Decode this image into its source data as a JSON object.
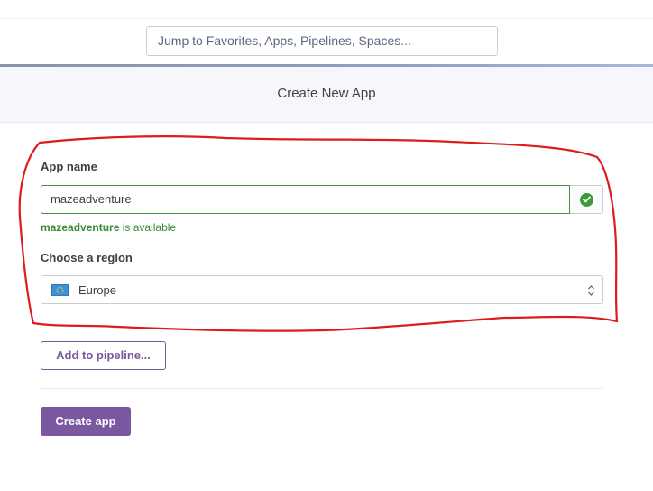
{
  "search": {
    "placeholder": "Jump to Favorites, Apps, Pipelines, Spaces..."
  },
  "header": {
    "title": "Create New App"
  },
  "form": {
    "app_name_label": "App name",
    "app_name_value": "mazeadventure",
    "availability_name": "mazeadventure",
    "availability_suffix": " is available",
    "region_label": "Choose a region",
    "region_value": "Europe",
    "region_icon": "eu-flag-icon",
    "status_icon": "check-circle-icon"
  },
  "actions": {
    "pipeline_label": "Add to pipeline...",
    "create_label": "Create app"
  },
  "colors": {
    "accent": "#79589f",
    "success": "#3b8a35",
    "annotation": "#dd1c1c"
  }
}
